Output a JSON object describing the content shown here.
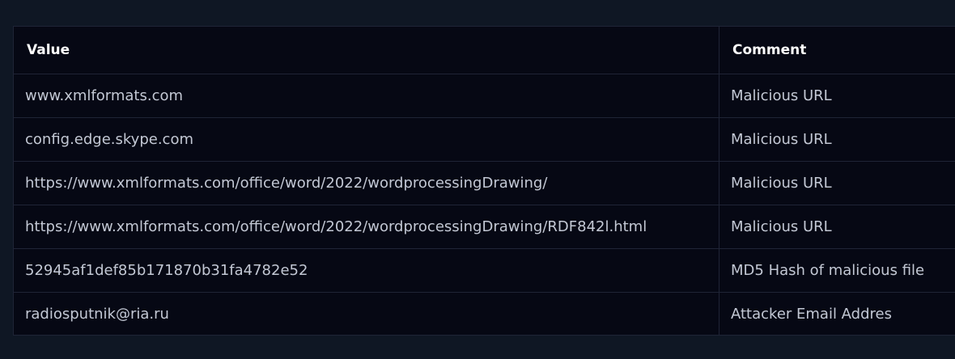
{
  "table": {
    "headers": [
      "Value",
      "Comment"
    ],
    "rows": [
      {
        "value": "www.xmlformats.com",
        "comment": "Malicious URL"
      },
      {
        "value": "config.edge.skype.com",
        "comment": "Malicious URL"
      },
      {
        "value": "https://www.xmlformats.com/office/word/2022/wordprocessingDrawing/",
        "comment": "Malicious URL"
      },
      {
        "value": "https://www.xmlformats.com/office/word/2022/wordprocessingDrawing/RDF842l.html",
        "comment": "Malicious URL"
      },
      {
        "value": "52945af1def85b171870b31fa4782e52",
        "comment": "MD5 Hash of malicious file"
      },
      {
        "value": "radiosputnik@ria.ru",
        "comment": "Attacker Email Addres"
      }
    ]
  },
  "colors": {
    "page_background": "#0f1724",
    "table_background": "#060814",
    "border": "#1f2436",
    "header_text": "#ffffff",
    "cell_text": "#c3c8d4"
  }
}
